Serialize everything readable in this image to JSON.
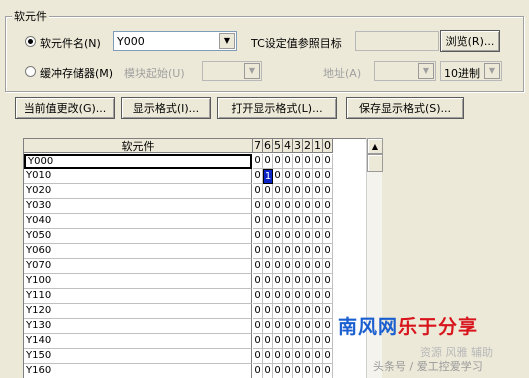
{
  "group": {
    "title": "软元件",
    "device_radio_label": "软元件名(N)",
    "device_value": "Y000",
    "tc_label": "TC设定值参照目标",
    "browse_button": "浏览(R)...",
    "buffer_radio_label": "缓冲存储器(M)",
    "module_start_label": "模块起始(U)",
    "address_label": "地址(A)",
    "radix_value": "10进制"
  },
  "buttons": {
    "change_current": "当前值更改(G)...",
    "display_format": "显示格式(I)...",
    "open_display_format": "打开显示格式(L)...",
    "save_display_format": "保存显示格式(S)..."
  },
  "table": {
    "name_header": "软元件",
    "bit_headers": [
      "7",
      "6",
      "5",
      "4",
      "3",
      "2",
      "1",
      "0"
    ],
    "rows": [
      {
        "name": "Y000",
        "bits": [
          "0",
          "0",
          "0",
          "0",
          "0",
          "0",
          "0",
          "0"
        ]
      },
      {
        "name": "Y010",
        "bits": [
          "0",
          "1",
          "0",
          "0",
          "0",
          "0",
          "0",
          "0"
        ]
      },
      {
        "name": "Y020",
        "bits": [
          "0",
          "0",
          "0",
          "0",
          "0",
          "0",
          "0",
          "0"
        ]
      },
      {
        "name": "Y030",
        "bits": [
          "0",
          "0",
          "0",
          "0",
          "0",
          "0",
          "0",
          "0"
        ]
      },
      {
        "name": "Y040",
        "bits": [
          "0",
          "0",
          "0",
          "0",
          "0",
          "0",
          "0",
          "0"
        ]
      },
      {
        "name": "Y050",
        "bits": [
          "0",
          "0",
          "0",
          "0",
          "0",
          "0",
          "0",
          "0"
        ]
      },
      {
        "name": "Y060",
        "bits": [
          "0",
          "0",
          "0",
          "0",
          "0",
          "0",
          "0",
          "0"
        ]
      },
      {
        "name": "Y070",
        "bits": [
          "0",
          "0",
          "0",
          "0",
          "0",
          "0",
          "0",
          "0"
        ]
      },
      {
        "name": "Y100",
        "bits": [
          "0",
          "0",
          "0",
          "0",
          "0",
          "0",
          "0",
          "0"
        ]
      },
      {
        "name": "Y110",
        "bits": [
          "0",
          "0",
          "0",
          "0",
          "0",
          "0",
          "0",
          "0"
        ]
      },
      {
        "name": "Y120",
        "bits": [
          "0",
          "0",
          "0",
          "0",
          "0",
          "0",
          "0",
          "0"
        ]
      },
      {
        "name": "Y130",
        "bits": [
          "0",
          "0",
          "0",
          "0",
          "0",
          "0",
          "0",
          "0"
        ]
      },
      {
        "name": "Y140",
        "bits": [
          "0",
          "0",
          "0",
          "0",
          "0",
          "0",
          "0",
          "0"
        ]
      },
      {
        "name": "Y150",
        "bits": [
          "0",
          "0",
          "0",
          "0",
          "0",
          "0",
          "0",
          "0"
        ]
      },
      {
        "name": "Y160",
        "bits": [
          "0",
          "0",
          "0",
          "0",
          "0",
          "0",
          "0",
          "0"
        ]
      }
    ],
    "selected_row": 0,
    "highlighted_cell": {
      "row": 1,
      "bit": 1
    }
  },
  "watermark": {
    "brand_blue": "南风网",
    "brand_red": "乐于分享",
    "sub": "资源 风雅 辅助",
    "toutiao": "头条号 / 爱工控爱学习"
  },
  "colors": {
    "background": "#ece9d8",
    "highlight": "#0a24c8",
    "brand_blue": "#1a5fd0",
    "brand_red": "#d8141c"
  }
}
